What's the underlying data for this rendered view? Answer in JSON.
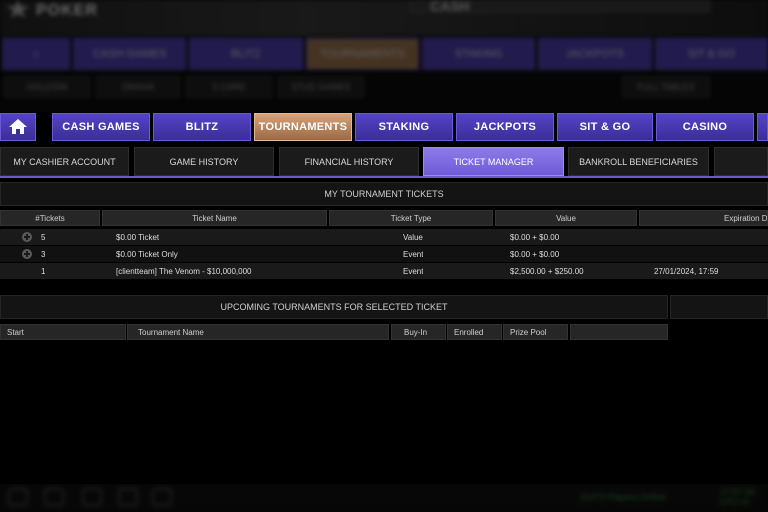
{
  "background": {
    "brand": "POKER",
    "cash_text": "CASH",
    "nav": [
      "CASH GAMES",
      "BLITZ",
      "TOURNAMENTS",
      "STAKING",
      "JACKPOTS",
      "SIT & GO"
    ],
    "sub": [
      "HOLD'EM",
      "OMAHA",
      "5 CARD",
      "STUD GAMES",
      "FULL TABLES"
    ],
    "players_online": "31473 Players Online",
    "time": "17:57:30\nUTC+0"
  },
  "nav": {
    "items": [
      {
        "label": "CASH GAMES"
      },
      {
        "label": "BLITZ"
      },
      {
        "label": "TOURNAMENTS"
      },
      {
        "label": "STAKING"
      },
      {
        "label": "JACKPOTS"
      },
      {
        "label": "SIT & GO"
      },
      {
        "label": "CASINO"
      }
    ],
    "active": "TOURNAMENTS"
  },
  "tabs": [
    {
      "label": "MY CASHIER ACCOUNT"
    },
    {
      "label": "GAME HISTORY"
    },
    {
      "label": "FINANCIAL HISTORY"
    },
    {
      "label": "TICKET MANAGER"
    },
    {
      "label": "BANKROLL BENEFICIARIES"
    }
  ],
  "tickets": {
    "title": "MY TOURNAMENT TICKETS",
    "columns": [
      "#Tickets",
      "Ticket Name",
      "Ticket Type",
      "Value",
      "Expiration Date"
    ],
    "rows": [
      {
        "count": "5",
        "name": "$0.00 Ticket",
        "type": "Value",
        "value": "$0.00 + $0.00",
        "expiration": ""
      },
      {
        "count": "3",
        "name": "$0.00 Ticket Only",
        "type": "Event",
        "value": "$0.00 + $0.00",
        "expiration": ""
      },
      {
        "count": "1",
        "name": "[clientteam] The Venom - $10,000,000",
        "type": "Event",
        "value": "$2,500.00 + $250.00",
        "expiration": "27/01/2024, 17:59"
      }
    ]
  },
  "upcoming": {
    "title": "UPCOMING TOURNAMENTS FOR SELECTED TICKET",
    "columns": [
      "Start",
      "Tournament Name",
      "Buy-In",
      "Enrolled",
      "Prize Pool",
      ""
    ]
  },
  "colors": {
    "nav_purple": "#4a3bb5",
    "nav_active": "#c08c62",
    "tab_active": "#7d69e0",
    "background": "#000000"
  }
}
